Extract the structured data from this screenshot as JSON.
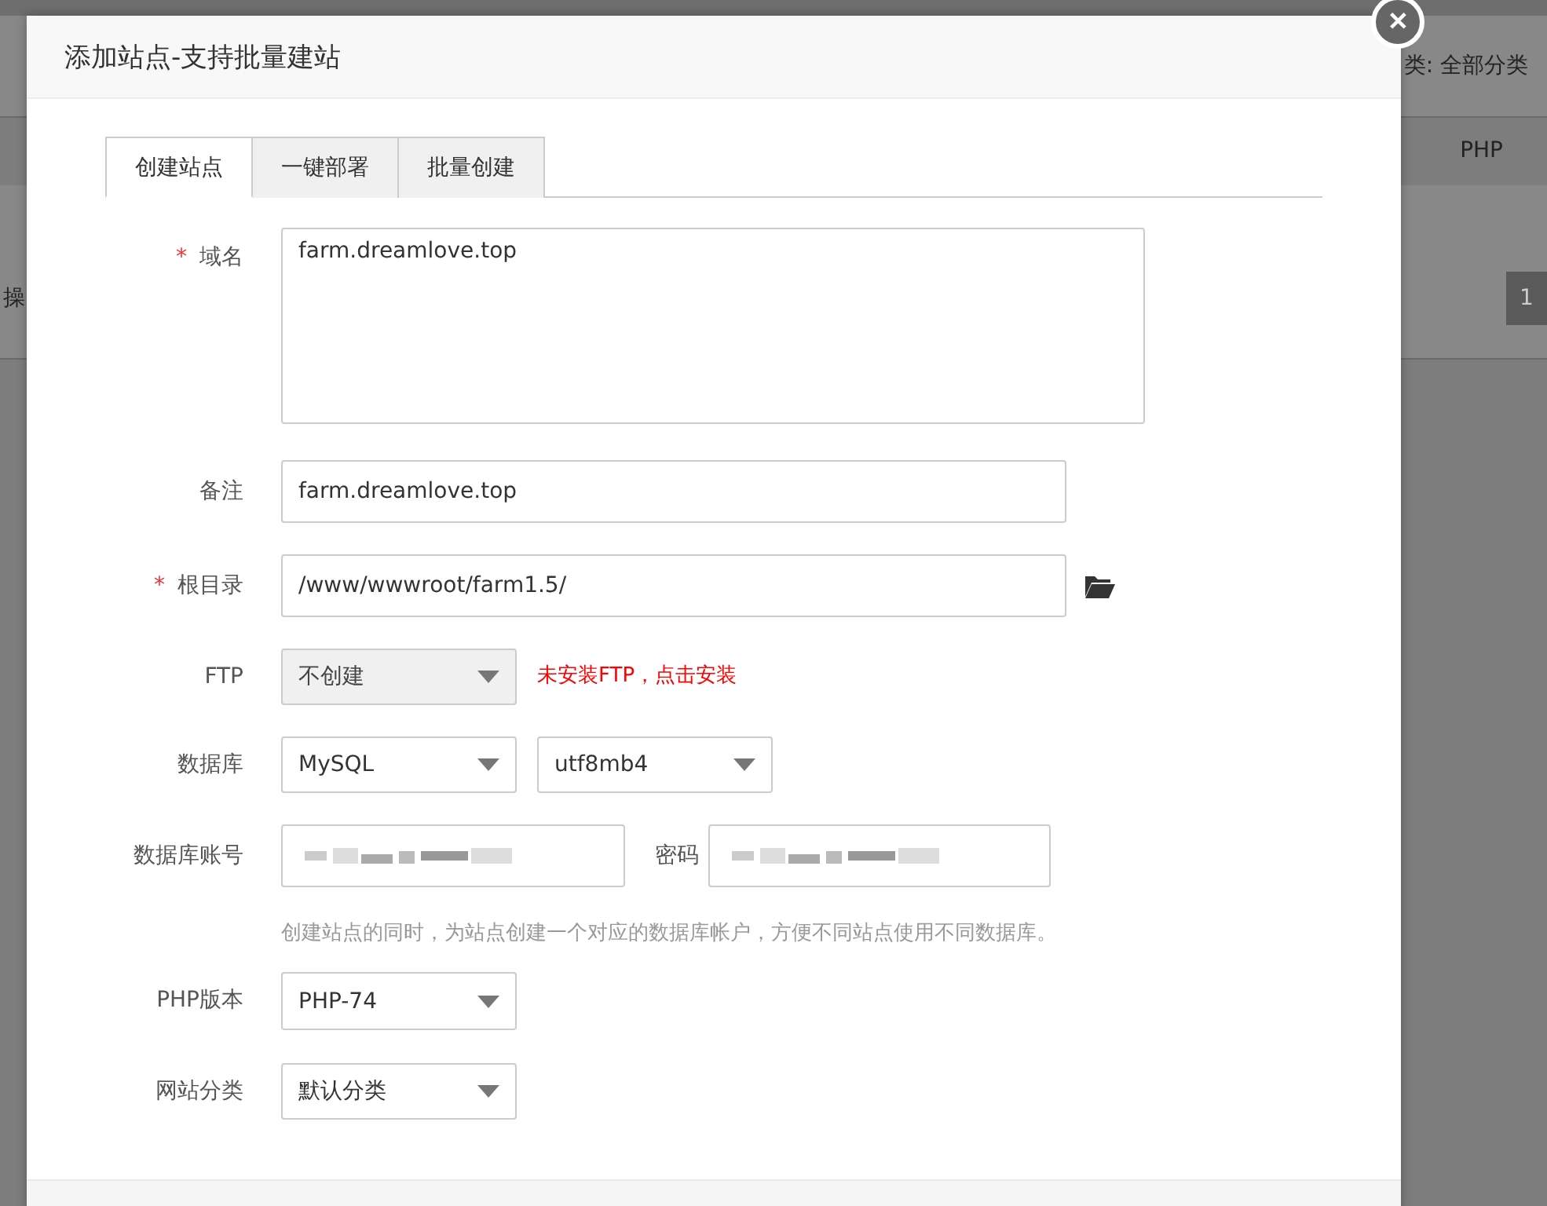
{
  "background": {
    "left_texts": [
      "操"
    ],
    "category_filter": "类: 全部分类",
    "column_header": "PHP",
    "pager": "1"
  },
  "dialog": {
    "title": "添加站点-支持批量建站",
    "close": "✕",
    "tabs": [
      {
        "label": "创建站点",
        "selected": true
      },
      {
        "label": "一键部署",
        "selected": false
      },
      {
        "label": "批量创建",
        "selected": false
      }
    ],
    "form": {
      "domain": {
        "label": "域名",
        "required_mark": "*",
        "value": "farm.dreamlove.top"
      },
      "remark": {
        "label": "备注",
        "value": "farm.dreamlove.top"
      },
      "root": {
        "label": "根目录",
        "required_mark": "*",
        "value": "/www/wwwroot/farm1.5/"
      },
      "ftp": {
        "label": "FTP",
        "value": "不创建",
        "disabled": true,
        "notice": "未安装FTP，点击安装"
      },
      "database": {
        "label": "数据库",
        "type": "MySQL",
        "charset": "utf8mb4"
      },
      "db_account": {
        "label": "数据库账号",
        "password_label": "密码",
        "hint": "创建站点的同时，为站点创建一个对应的数据库帐户，方便不同站点使用不同数据库。"
      },
      "php": {
        "label": "PHP版本",
        "value": "PHP-74"
      },
      "category": {
        "label": "网站分类",
        "value": "默认分类"
      }
    }
  }
}
